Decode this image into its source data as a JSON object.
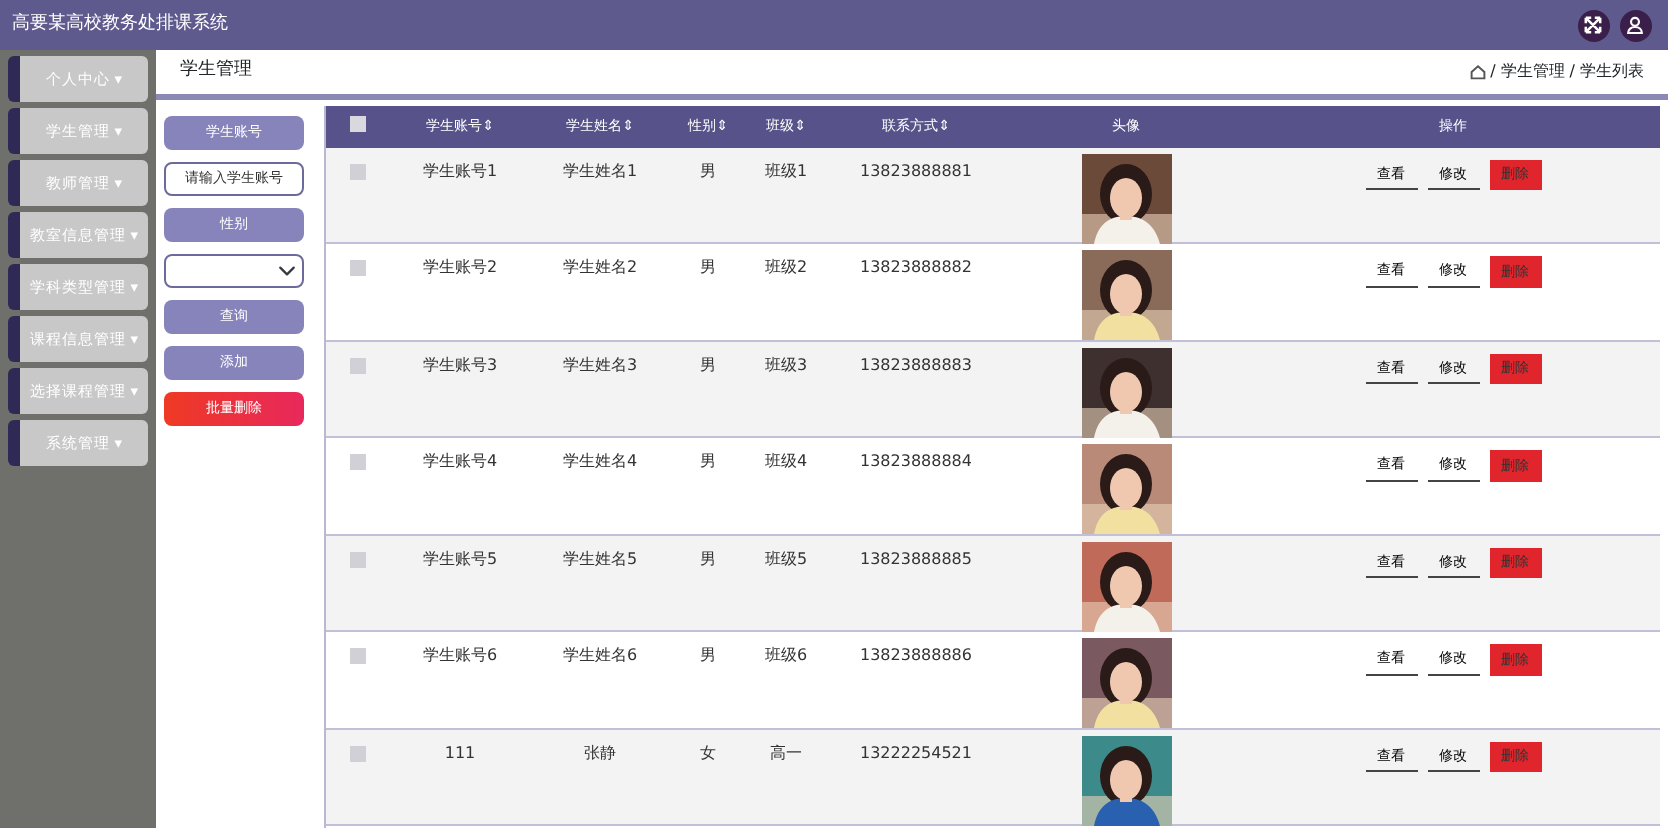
{
  "app_title": "高要某高校教务处排课系统",
  "sidebar": {
    "items": [
      {
        "label": "个人中心",
        "caret": "▾"
      },
      {
        "label": "学生管理",
        "caret": "▾"
      },
      {
        "label": "教师管理",
        "caret": "▾"
      },
      {
        "label": "教室信息管理",
        "caret": "▾"
      },
      {
        "label": "学科类型管理",
        "caret": "▾"
      },
      {
        "label": "课程信息管理",
        "caret": "▾"
      },
      {
        "label": "选择课程管理",
        "caret": "▾"
      },
      {
        "label": "系统管理",
        "caret": "▾"
      }
    ]
  },
  "page_title": "学生管理",
  "breadcrumb": [
    {
      "separator": "/",
      "label": "学生管理"
    },
    {
      "separator": "/",
      "label": "学生列表"
    }
  ],
  "filters": {
    "account_label": "学生账号",
    "account_placeholder": "请输入学生账号",
    "gender_label": "性别",
    "search_button": "查询",
    "add_button": "添加",
    "batch_delete_button": "批量删除"
  },
  "table": {
    "select_all_checked": false,
    "columns": [
      "学生账号⇕",
      "学生姓名⇕",
      "性别⇕",
      "班级⇕",
      "联系方式⇕",
      "头像",
      "操作"
    ],
    "rows": [
      {
        "checked": false,
        "account": "学生账号1",
        "name": "学生姓名1",
        "gender": "男",
        "class": "班级1",
        "phone": "13823888881",
        "actions": [
          "查看",
          "修改",
          "删除"
        ]
      },
      {
        "checked": false,
        "account": "学生账号2",
        "name": "学生姓名2",
        "gender": "男",
        "class": "班级2",
        "phone": "13823888882",
        "actions": [
          "查看",
          "修改",
          "删除"
        ]
      },
      {
        "checked": false,
        "account": "学生账号3",
        "name": "学生姓名3",
        "gender": "男",
        "class": "班级3",
        "phone": "13823888883",
        "actions": [
          "查看",
          "修改",
          "删除"
        ]
      },
      {
        "checked": false,
        "account": "学生账号4",
        "name": "学生姓名4",
        "gender": "男",
        "class": "班级4",
        "phone": "13823888884",
        "actions": [
          "查看",
          "修改",
          "删除"
        ]
      },
      {
        "checked": false,
        "account": "学生账号5",
        "name": "学生姓名5",
        "gender": "男",
        "class": "班级5",
        "phone": "13823888885",
        "actions": [
          "查看",
          "修改",
          "删除"
        ]
      },
      {
        "checked": false,
        "account": "学生账号6",
        "name": "学生姓名6",
        "gender": "男",
        "class": "班级6",
        "phone": "13823888886",
        "actions": [
          "查看",
          "修改",
          "删除"
        ]
      },
      {
        "checked": false,
        "account": "111",
        "name": "张静",
        "gender": "女",
        "class": "高一",
        "phone": "13222254521",
        "actions": [
          "查看",
          "修改",
          "删除"
        ]
      }
    ]
  }
}
